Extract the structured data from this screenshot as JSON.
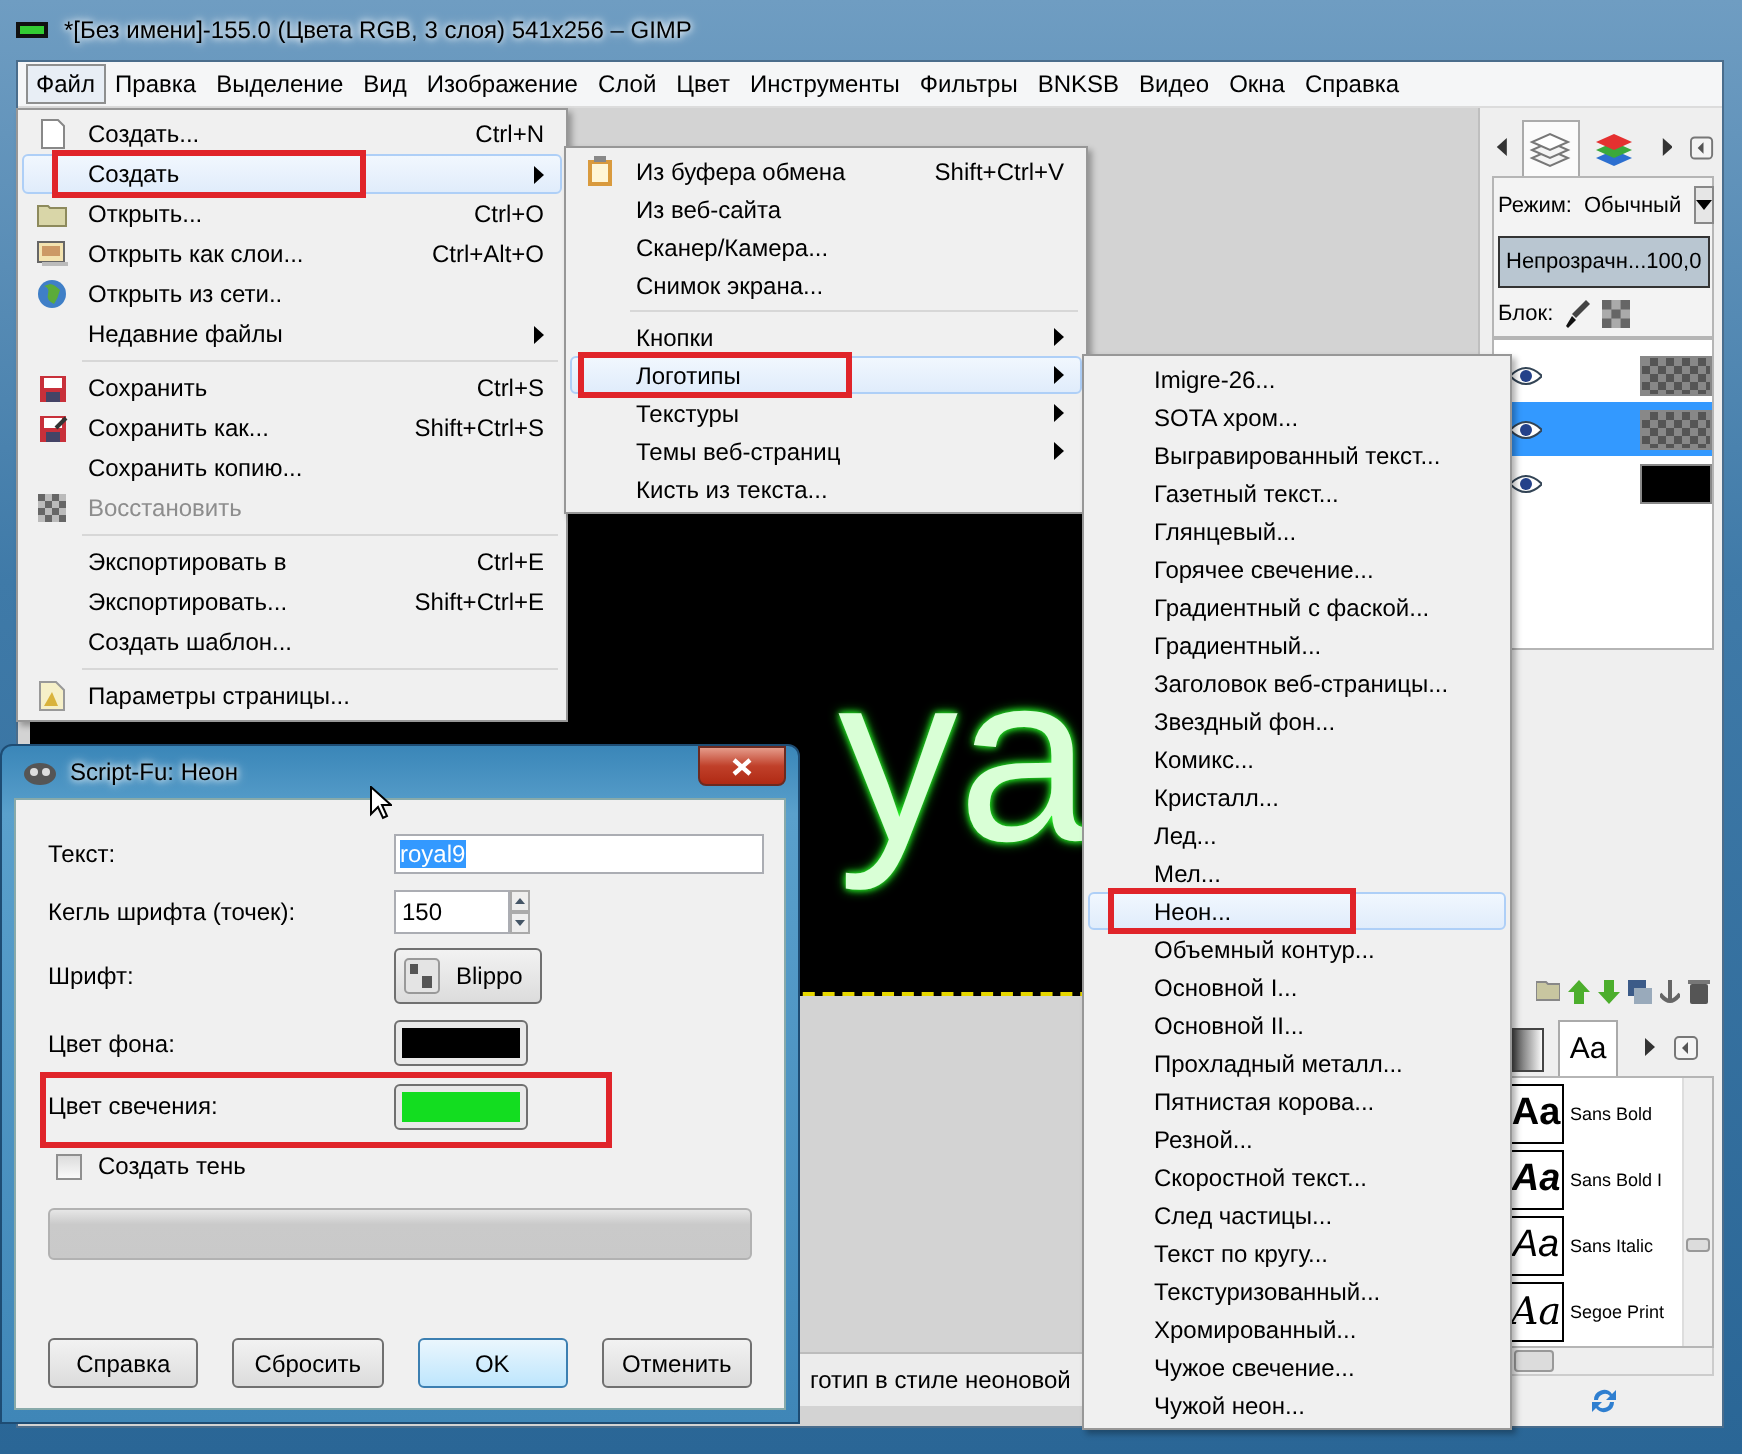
{
  "window": {
    "title": "*[Без имени]-155.0 (Цвета RGB, 3 слоя) 541x256 – GIMP"
  },
  "menubar": [
    {
      "label": "Файл",
      "selected": true
    },
    {
      "label": "Правка",
      "selected": false
    },
    {
      "label": "Выделение",
      "selected": false
    },
    {
      "label": "Вид",
      "selected": false
    },
    {
      "label": "Изображение",
      "selected": false
    },
    {
      "label": "Слой",
      "selected": false
    },
    {
      "label": "Цвет",
      "selected": false
    },
    {
      "label": "Инструменты",
      "selected": false
    },
    {
      "label": "Фильтры",
      "selected": false
    },
    {
      "label": "BNKSB",
      "selected": false
    },
    {
      "label": "Видео",
      "selected": false
    },
    {
      "label": "Окна",
      "selected": false
    },
    {
      "label": "Справка",
      "selected": false
    }
  ],
  "image": {
    "text": "ya"
  },
  "status_bar": {
    "text": "готип в стиле неоновой"
  },
  "file_menu": [
    {
      "kind": "item",
      "label": "Создать...",
      "shortcut": "Ctrl+N",
      "submenu": false,
      "selected": false,
      "disabled": false
    },
    {
      "kind": "item",
      "label": "Создать",
      "submenu": true,
      "selected": true,
      "disabled": false
    },
    {
      "kind": "item",
      "label": "Открыть...",
      "shortcut": "Ctrl+O",
      "submenu": false,
      "selected": false,
      "disabled": false
    },
    {
      "kind": "item",
      "label": "Открыть как слои...",
      "shortcut": "Ctrl+Alt+O",
      "submenu": false,
      "selected": false,
      "disabled": false
    },
    {
      "kind": "item",
      "label": "Открыть из сети..",
      "submenu": false,
      "selected": false,
      "disabled": false
    },
    {
      "kind": "item",
      "label": "Недавние файлы",
      "submenu": true,
      "selected": false,
      "disabled": false
    },
    {
      "kind": "separator"
    },
    {
      "kind": "item",
      "label": "Сохранить",
      "shortcut": "Ctrl+S",
      "submenu": false,
      "selected": false,
      "disabled": false
    },
    {
      "kind": "item",
      "label": "Сохранить как...",
      "shortcut": "Shift+Ctrl+S",
      "submenu": false,
      "selected": false,
      "disabled": false
    },
    {
      "kind": "item",
      "label": "Сохранить копию...",
      "submenu": false,
      "selected": false,
      "disabled": false
    },
    {
      "kind": "item",
      "label": "Восстановить",
      "submenu": false,
      "selected": false,
      "disabled": true
    },
    {
      "kind": "separator"
    },
    {
      "kind": "item",
      "label": "Экспортировать в",
      "shortcut": "Ctrl+E",
      "submenu": false,
      "selected": false,
      "disabled": false
    },
    {
      "kind": "item",
      "label": "Экспортировать...",
      "shortcut": "Shift+Ctrl+E",
      "submenu": false,
      "selected": false,
      "disabled": false
    },
    {
      "kind": "item",
      "label": "Создать шаблон...",
      "submenu": false,
      "selected": false,
      "disabled": false
    },
    {
      "kind": "separator"
    },
    {
      "kind": "item",
      "label": "Параметры страницы...",
      "submenu": false,
      "selected": false,
      "disabled": false
    }
  ],
  "create_menu": [
    {
      "kind": "item",
      "label": "Из буфера обмена",
      "shortcut": "Shift+Ctrl+V",
      "submenu": false,
      "selected": false
    },
    {
      "kind": "item",
      "label": "Из веб-сайта",
      "submenu": false,
      "selected": false
    },
    {
      "kind": "item",
      "label": "Сканер/Камера...",
      "submenu": false,
      "selected": false
    },
    {
      "kind": "item",
      "label": "Снимок экрана...",
      "submenu": false,
      "selected": false
    },
    {
      "kind": "separator"
    },
    {
      "kind": "item",
      "label": "Кнопки",
      "submenu": true,
      "selected": false
    },
    {
      "kind": "item",
      "label": "Логотипы",
      "submenu": true,
      "selected": true
    },
    {
      "kind": "item",
      "label": "Текстуры",
      "submenu": true,
      "selected": false
    },
    {
      "kind": "item",
      "label": "Темы веб-страниц",
      "submenu": true,
      "selected": false
    },
    {
      "kind": "item",
      "label": "Кисть из текста...",
      "submenu": false,
      "selected": false
    }
  ],
  "logos_menu": [
    {
      "label": "Imigre-26...",
      "selected": false
    },
    {
      "label": "SOTA хром...",
      "selected": false
    },
    {
      "label": "Выгравированный текст...",
      "selected": false
    },
    {
      "label": "Газетный текст...",
      "selected": false
    },
    {
      "label": "Глянцевый...",
      "selected": false
    },
    {
      "label": "Горячее свечение...",
      "selected": false
    },
    {
      "label": "Градиентный с фаской...",
      "selected": false
    },
    {
      "label": "Градиентный...",
      "selected": false
    },
    {
      "label": "Заголовок веб-страницы...",
      "selected": false
    },
    {
      "label": "Звездный фон...",
      "selected": false
    },
    {
      "label": "Комикс...",
      "selected": false
    },
    {
      "label": "Кристалл...",
      "selected": false
    },
    {
      "label": "Лед...",
      "selected": false
    },
    {
      "label": "Мел...",
      "selected": false
    },
    {
      "label": "Неон...",
      "selected": true
    },
    {
      "label": "Объемный контур...",
      "selected": false
    },
    {
      "label": "Основной I...",
      "selected": false
    },
    {
      "label": "Основной II...",
      "selected": false
    },
    {
      "label": "Прохладный металл...",
      "selected": false
    },
    {
      "label": "Пятнистая корова...",
      "selected": false
    },
    {
      "label": "Резной...",
      "selected": false
    },
    {
      "label": "Скоростной текст...",
      "selected": false
    },
    {
      "label": "След частицы...",
      "selected": false
    },
    {
      "label": "Текст по кругу...",
      "selected": false
    },
    {
      "label": "Текстуризованный...",
      "selected": false
    },
    {
      "label": "Хромированный...",
      "selected": false
    },
    {
      "label": "Чужое свечение...",
      "selected": false
    },
    {
      "label": "Чужой неон...",
      "selected": false
    }
  ],
  "dock": {
    "tabs": [
      {
        "selected": true
      },
      {
        "selected": false
      }
    ],
    "mode": {
      "label": "Режим:",
      "value": "Обычный"
    },
    "opacity": {
      "label": "Непрозрачн...",
      "value": "100,0",
      "level": 1
    },
    "lock": {
      "label": "Блок:"
    },
    "layers": [
      {
        "visible": true,
        "selected": false
      },
      {
        "visible": true,
        "selected": true
      },
      {
        "visible": true,
        "selected": false
      }
    ],
    "resource_tabs": [
      {
        "selected": false
      },
      {
        "label": "Aa",
        "selected": true
      }
    ],
    "fonts": [
      {
        "preview": "Aa",
        "name": "Sans Bold",
        "kind": "bold"
      },
      {
        "preview": "Aa",
        "name": "Sans Bold I",
        "kind": "bolditalic"
      },
      {
        "preview": "Aa",
        "name": "Sans Italic",
        "kind": "italic"
      },
      {
        "preview": "Aa",
        "name": "Segoe Print",
        "kind": "script"
      }
    ]
  },
  "dialog": {
    "title": "Script-Fu: Неон",
    "fields": [
      {
        "kind": "text",
        "label": "Текст:",
        "value": "royal9"
      },
      {
        "kind": "spin",
        "label": "Кегль шрифта (точек):",
        "value": "150"
      },
      {
        "kind": "font",
        "label": "Шрифт:",
        "value": "Blippo"
      },
      {
        "kind": "color",
        "label": "Цвет фона:",
        "color": "#000000"
      },
      {
        "kind": "color",
        "label": "Цвет свечения:",
        "color": "#13dd20"
      }
    ],
    "shadow": {
      "label": "Создать тень",
      "checked": false
    },
    "progress": {
      "level": 0
    },
    "buttons": [
      {
        "label": "Справка",
        "default": false
      },
      {
        "label": "Сбросить",
        "default": false
      },
      {
        "label": "OK",
        "default": true
      },
      {
        "label": "Отменить",
        "default": false
      }
    ]
  }
}
